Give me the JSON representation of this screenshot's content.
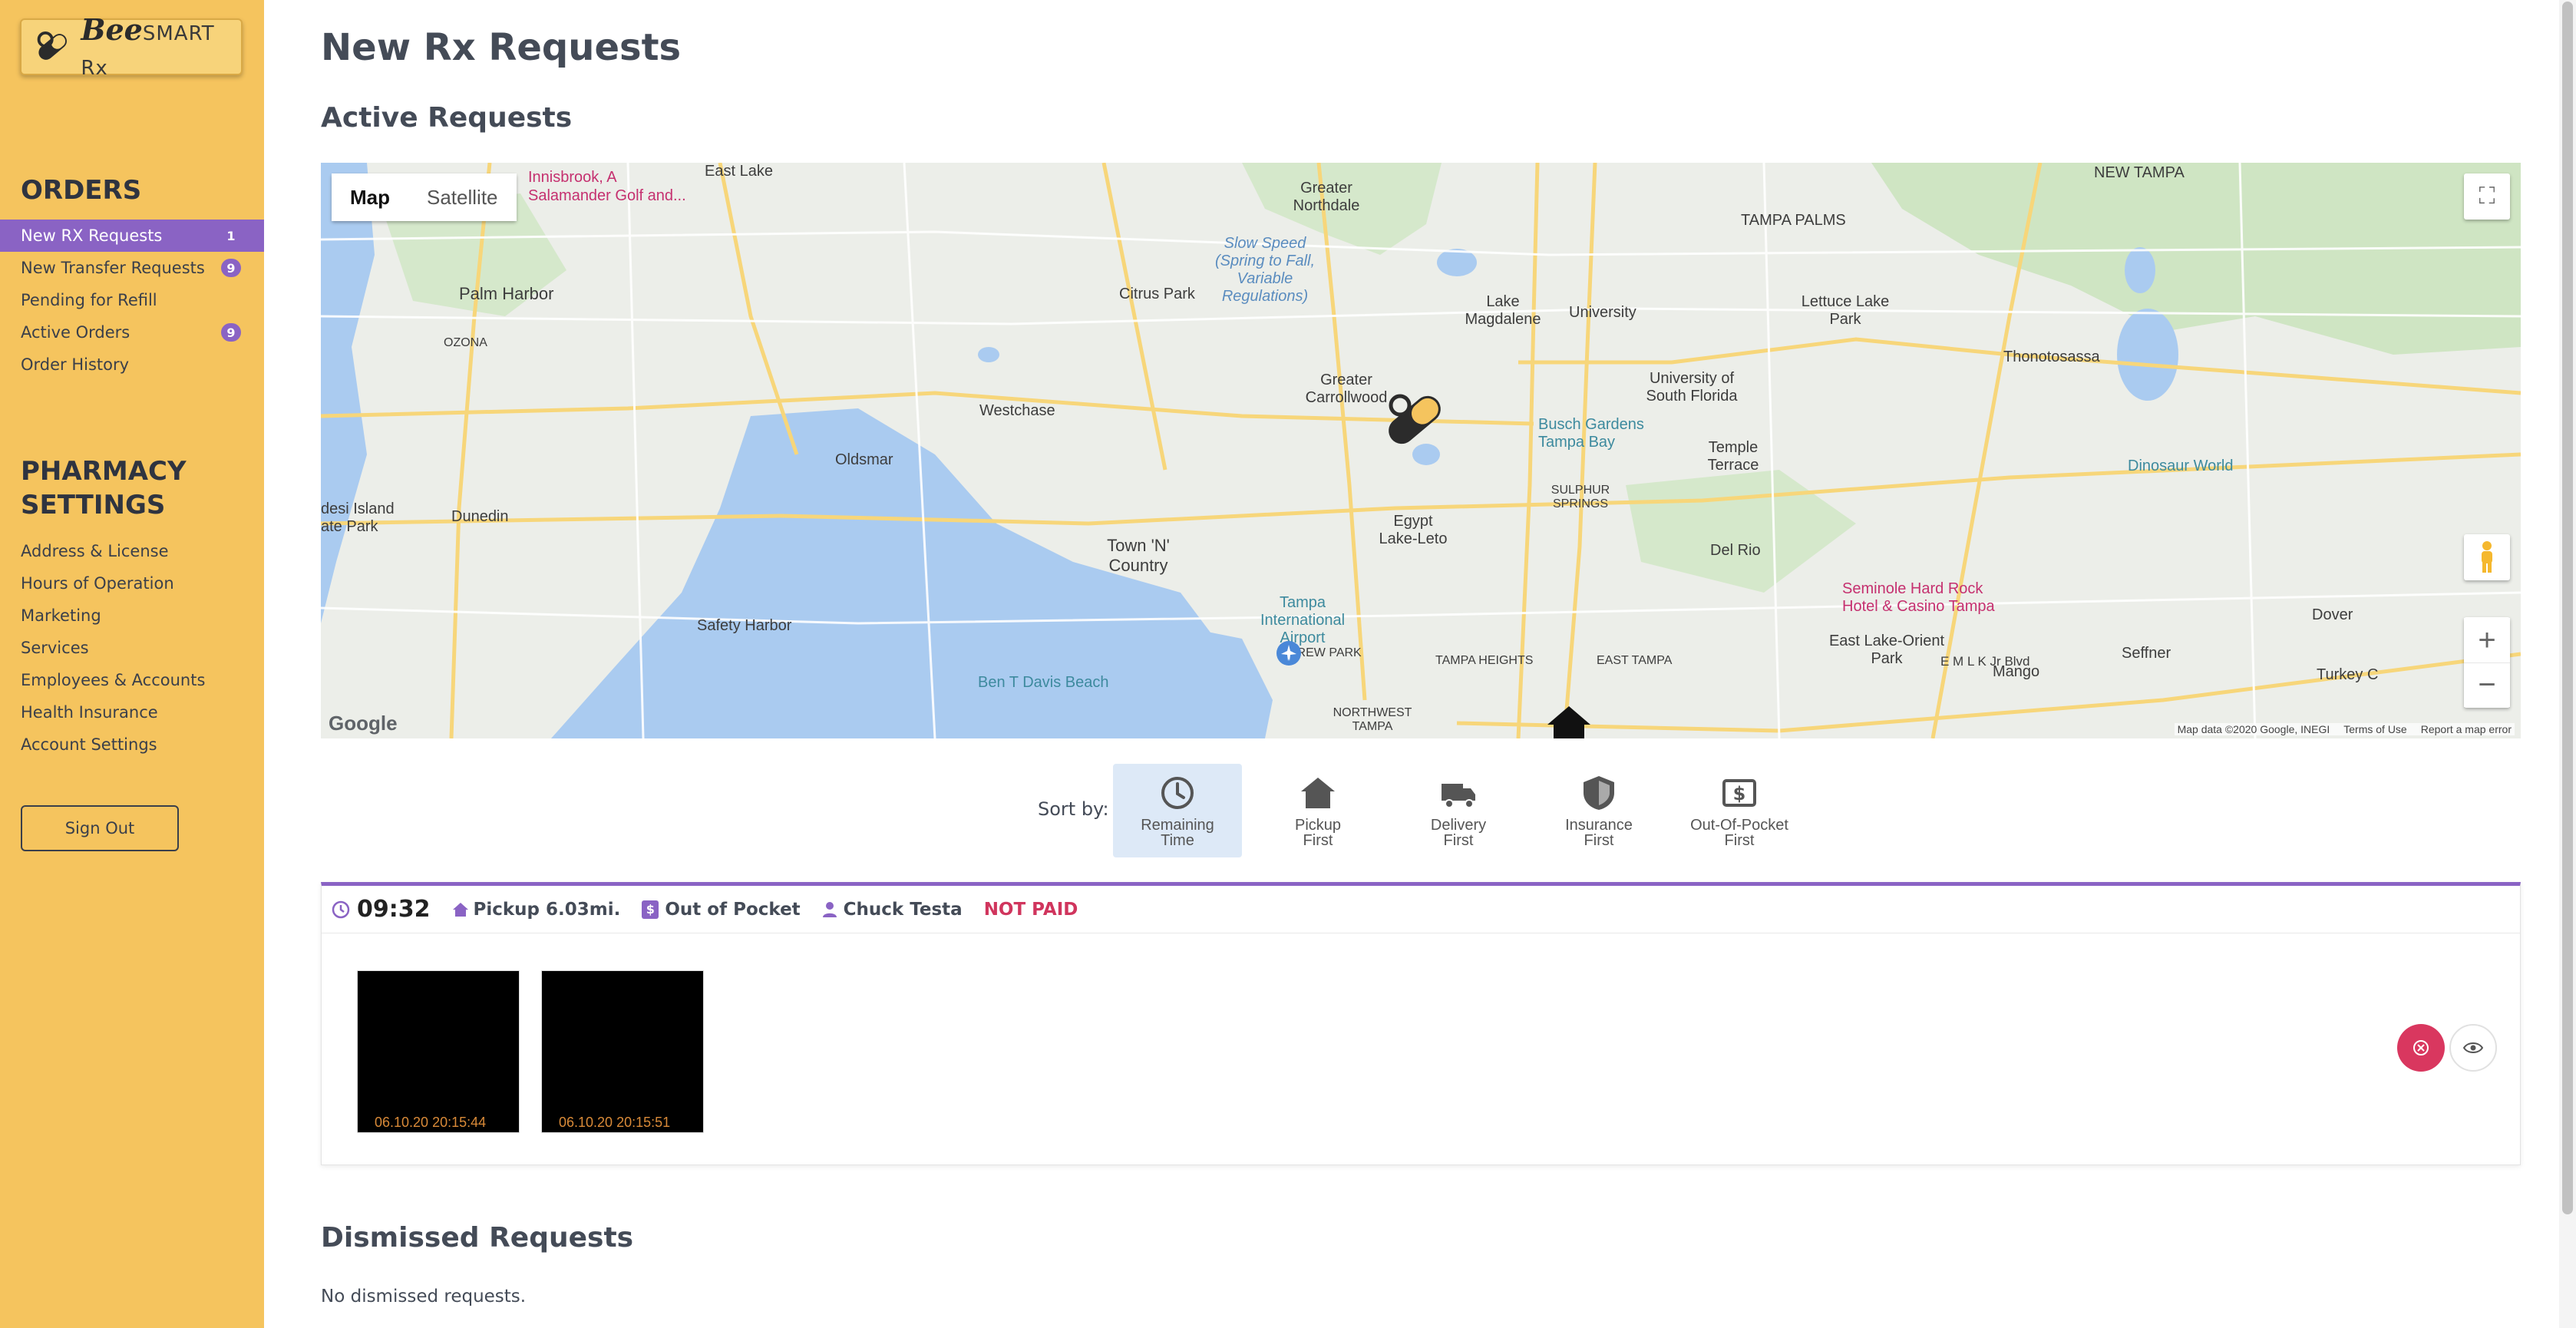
{
  "app": {
    "logo_text": "Bee",
    "logo_sub": "SMART Rx"
  },
  "sidebar": {
    "orders_title": "ORDERS",
    "orders": [
      {
        "label": "New RX Requests",
        "badge": "1"
      },
      {
        "label": "New Transfer Requests",
        "badge": "9"
      },
      {
        "label": "Pending for Refill",
        "badge": ""
      },
      {
        "label": "Active Orders",
        "badge": "9"
      },
      {
        "label": "Order History",
        "badge": ""
      }
    ],
    "settings_title_1": "PHARMACY",
    "settings_title_2": "SETTINGS",
    "settings": [
      {
        "label": "Address & License"
      },
      {
        "label": "Hours of Operation"
      },
      {
        "label": "Marketing"
      },
      {
        "label": "Services"
      },
      {
        "label": "Employees & Accounts"
      },
      {
        "label": "Health Insurance"
      },
      {
        "label": "Account Settings"
      }
    ],
    "sign_out": "Sign Out"
  },
  "main": {
    "title": "New Rx Requests",
    "active_title": "Active Requests",
    "map": {
      "type_map": "Map",
      "type_satellite": "Satellite",
      "attribution": "Map data ©2020 Google, INEGI",
      "terms": "Terms of Use",
      "report": "Report a map error",
      "google": "Google",
      "labels": {
        "east_lake": "East Lake",
        "innisbrook": "Innisbrook, A",
        "salamander": "Salamander Golf and...",
        "new_tampa": "NEW TAMPA",
        "greater_northdale": "Greater Northdale",
        "tampa_palms": "TAMPA PALMS",
        "slow_speed": "Slow Speed (Spring to Fall, Variable Regulations)",
        "palm_harbor": "Palm Harbor",
        "ozona": "OZONA",
        "citrus_park": "Citrus Park",
        "lake_magdalene": "Lake Magdalene",
        "university": "University",
        "lettuce_lake": "Lettuce Lake Park",
        "thonotosassa": "Thonotosassa",
        "greater_carrollwood": "Greater Carrollwood",
        "westchase": "Westchase",
        "usf": "University of South Florida",
        "busch": "Busch Gardens Tampa Bay",
        "temple_terrace": "Temple Terrace",
        "oldsmar": "Oldsmar",
        "dinosaur": "Dinosaur World",
        "dunedin": "Dunedin",
        "sulphur": "SULPHUR SPRINGS",
        "egypt": "Egypt Lake-Leto",
        "town_n_country": "Town 'N' Country",
        "desi_island": "desi Island ate Park",
        "del_rio": "Del Rio",
        "seminole": "Seminole Hard Rock Hotel & Casino Tampa",
        "safety_harbor": "Safety Harbor",
        "tampa_airport": "Tampa International Airport",
        "dover": "Dover",
        "east_lake_orient": "East Lake-Orient Park",
        "seffner": "Seffner",
        "mango": "Mango",
        "ben_davis": "Ben T Davis Beach",
        "drew_park": "DREW PARK",
        "tampa_heights": "TAMPA HEIGHTS",
        "east_tampa": "EAST TAMPA",
        "northwest_tampa": "NORTHWEST TAMPA",
        "turkey": "Turkey C",
        "emlk": "E M L K Jr Blvd"
      }
    },
    "sort": {
      "label": "Sort by:",
      "options": [
        {
          "line1": "Remaining",
          "line2": "Time"
        },
        {
          "line1": "Pickup",
          "line2": "First"
        },
        {
          "line1": "Delivery",
          "line2": "First"
        },
        {
          "line1": "Insurance",
          "line2": "First"
        },
        {
          "line1": "Out-Of-Pocket",
          "line2": "First"
        }
      ]
    },
    "request": {
      "timer": "09:32",
      "pickup": "Pickup 6.03mi.",
      "payment_icon": "$",
      "payment": "Out of Pocket",
      "customer": "Chuck Testa",
      "status": "NOT PAID",
      "images": [
        {
          "timestamp": "06.10.20 20:15:44"
        },
        {
          "timestamp": "06.10.20 20:15:51"
        }
      ]
    },
    "dismissed_title": "Dismissed Requests",
    "dismissed_text": "No dismissed requests."
  },
  "colors": {
    "sidebar": "#f5c45e",
    "accent": "#8a63c4",
    "danger": "#d0355d"
  }
}
